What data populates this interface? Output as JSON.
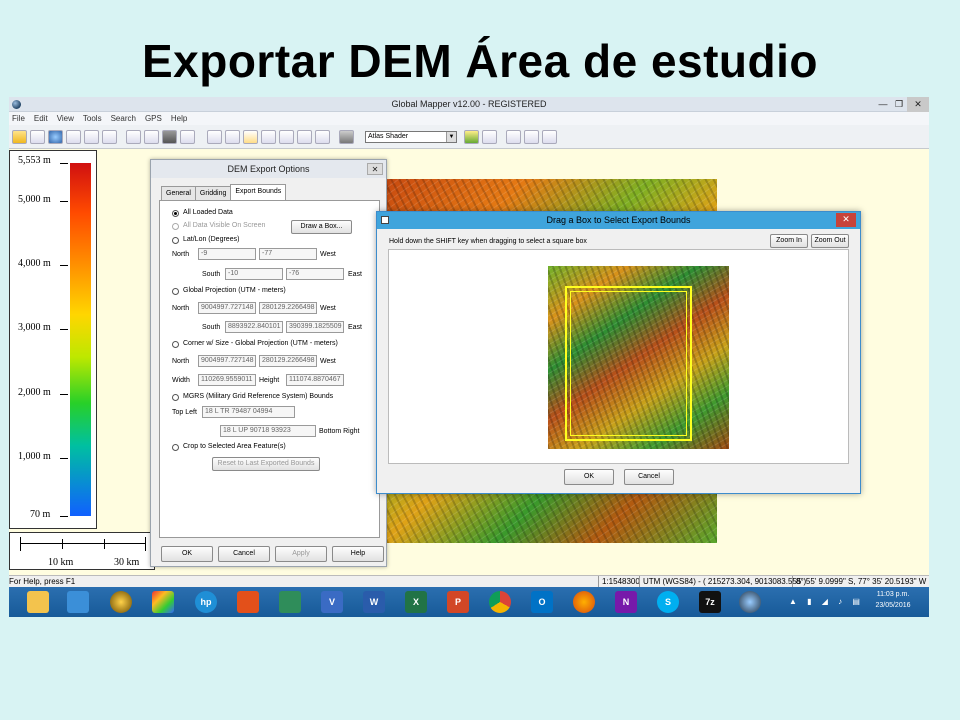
{
  "slide": {
    "title": "Exportar DEM Área de estudio"
  },
  "app": {
    "title": "Global Mapper v12.00 - REGISTERED",
    "window_buttons": {
      "minimize": "—",
      "restore": "❐",
      "close": "✕"
    },
    "menu": [
      "File",
      "Edit",
      "View",
      "Tools",
      "Search",
      "GPS",
      "Help"
    ],
    "shader": "Atlas Shader"
  },
  "legend": {
    "labels": [
      "5,553 m",
      "5,000 m",
      "4,000 m",
      "3,000 m",
      "2,000 m",
      "1,000 m",
      "70 m"
    ],
    "scale_labels": [
      "10 km",
      "30 km"
    ]
  },
  "export_dialog": {
    "title": "DEM Export Options",
    "close": "✕",
    "tabs": [
      "General",
      "Gridding",
      "Export Bounds"
    ],
    "all_loaded": "All Loaded Data",
    "all_visible": "All Data Visible On Screen",
    "draw_box": "Draw a Box...",
    "latlon": "Lat/Lon (Degrees)",
    "north": "North",
    "south": "South",
    "west": "West",
    "east": "East",
    "width": "Width",
    "height": "Height",
    "latlon_north": "-9",
    "latlon_west": "-77",
    "latlon_south": "-10",
    "latlon_east": "-76",
    "gp_label": "Global Projection (UTM - meters)",
    "gp_north": "9004997.727148",
    "gp_west": "280129.2266498",
    "gp_south": "8893922.840101",
    "gp_east": "390399.1825509",
    "corner_label": "Corner w/ Size - Global Projection (UTM - meters)",
    "corner_north": "9004997.727148",
    "corner_west": "280129.2266498",
    "corner_width": "110269.9559011",
    "corner_height": "111074.8870467",
    "mgrs_label": "MGRS (Military Grid Reference System) Bounds",
    "top_left": "Top Left",
    "mgrs_tl": "18 L TR 79487 04994",
    "mgrs_br": "18 L UP 90718 93923",
    "bottom_right": "Bottom Right",
    "crop_label": "Crop to Selected Area Feature(s)",
    "reset": "Reset to Last Exported Bounds",
    "ok": "OK",
    "cancel": "Cancel",
    "apply": "Apply",
    "help": "Help"
  },
  "drag_dialog": {
    "title": "Drag a Box to Select Export Bounds",
    "close": "✕",
    "instruction": "Hold down the SHIFT key when dragging to select a square box",
    "zoom_in": "Zoom In",
    "zoom_out": "Zoom Out",
    "ok": "OK",
    "cancel": "Cancel"
  },
  "status": {
    "help": "For Help, press F1",
    "scale": "1:1548300",
    "coords": "UTM (WGS84) - ( 215273.304, 9013083.555 )",
    "latlon": "8° 55' 9.0999\" S, 77° 35' 20.5193\" W"
  },
  "taskbar": {
    "icons": [
      "file-explorer",
      "rocket",
      "media-player",
      "photo-app",
      "hp",
      "office",
      "publisher",
      "visio",
      "word",
      "excel",
      "powerpoint",
      "chrome",
      "outlook",
      "firefox",
      "onenote",
      "skype",
      "7zip",
      "global-mapper"
    ],
    "time": "11:03 p.m.",
    "date": "23/05/2016"
  }
}
